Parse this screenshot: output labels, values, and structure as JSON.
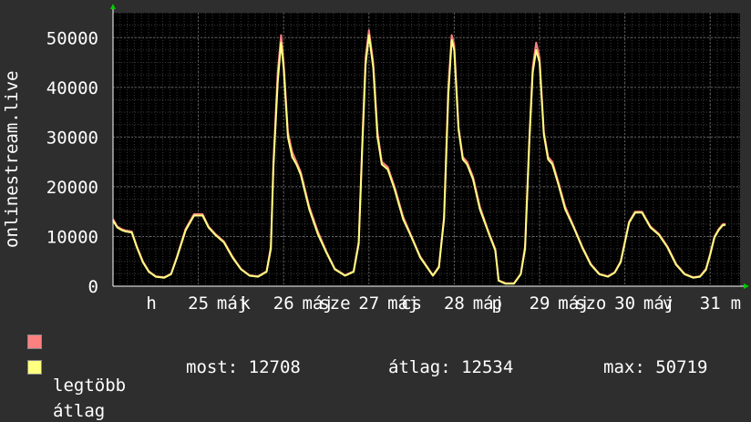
{
  "colors": {
    "background": "#2e2e2e",
    "plot_background": "#000000",
    "grid_major": "#606060",
    "grid_minor": "#3a3a3a",
    "max_line": "#ff8080",
    "avg_line": "#ffff80",
    "axis": "#ffffff",
    "arrow": "#00cc00"
  },
  "legend": {
    "max_label": "legtöbb",
    "avg_label": "átlag"
  },
  "stats": {
    "now": "most: 12708",
    "avg": "átlag: 12534",
    "max": "max: 50719"
  },
  "chart_data": {
    "type": "line",
    "ylabel": "onlinestream.live",
    "ylim": [
      0,
      55000
    ],
    "yticks": [
      0,
      10000,
      20000,
      30000,
      40000,
      50000
    ],
    "ytick_labels": [
      "0",
      "10000",
      "20000",
      "30000",
      "40000",
      "50000"
    ],
    "xlim": [
      24.0,
      31.35
    ],
    "grid": true,
    "xtick_labels": [
      {
        "x": 24.45,
        "label": "h"
      },
      {
        "x": 25.0,
        "label": "25"
      },
      {
        "x": 25.4,
        "label": "máj"
      },
      {
        "x": 25.55,
        "label": "k"
      },
      {
        "x": 26.0,
        "label": "26"
      },
      {
        "x": 26.4,
        "label": "máj"
      },
      {
        "x": 26.6,
        "label": "sze"
      },
      {
        "x": 27.0,
        "label": "27"
      },
      {
        "x": 27.4,
        "label": "máj"
      },
      {
        "x": 27.5,
        "label": "cs"
      },
      {
        "x": 28.0,
        "label": "28"
      },
      {
        "x": 28.4,
        "label": "máj"
      },
      {
        "x": 28.5,
        "label": "p"
      },
      {
        "x": 29.0,
        "label": "29"
      },
      {
        "x": 29.4,
        "label": "máj"
      },
      {
        "x": 29.6,
        "label": "szo"
      },
      {
        "x": 30.0,
        "label": "30"
      },
      {
        "x": 30.4,
        "label": "máj"
      },
      {
        "x": 30.5,
        "label": "v"
      },
      {
        "x": 31.0,
        "label": "31"
      },
      {
        "x": 31.3,
        "label": "m"
      }
    ],
    "series": [
      {
        "name": "legtöbb",
        "x": [
          24.0,
          24.05,
          24.1,
          24.15,
          24.22,
          24.28,
          24.35,
          24.42,
          24.5,
          24.6,
          24.68,
          24.75,
          24.85,
          24.95,
          25.05,
          25.12,
          25.2,
          25.3,
          25.4,
          25.5,
          25.6,
          25.7,
          25.8,
          25.85,
          25.88,
          25.93,
          25.97,
          26.0,
          26.05,
          26.1,
          26.15,
          26.2,
          26.3,
          26.4,
          26.5,
          26.6,
          26.72,
          26.82,
          26.88,
          26.92,
          26.96,
          27.0,
          27.05,
          27.1,
          27.15,
          27.22,
          27.3,
          27.4,
          27.5,
          27.6,
          27.75,
          27.82,
          27.88,
          27.93,
          27.97,
          28.0,
          28.05,
          28.1,
          28.15,
          28.22,
          28.3,
          28.4,
          28.48,
          28.5,
          28.52,
          28.6,
          28.7,
          28.78,
          28.83,
          28.88,
          28.92,
          28.96,
          29.0,
          29.05,
          29.1,
          29.15,
          29.22,
          29.3,
          29.4,
          29.5,
          29.6,
          29.7,
          29.8,
          29.88,
          29.95,
          30.05,
          30.12,
          30.2,
          30.3,
          30.4,
          30.5,
          30.6,
          30.7,
          30.8,
          30.88,
          30.95,
          31.0,
          31.05,
          31.1,
          31.15,
          31.18
        ],
        "y": [
          13500,
          12000,
          11500,
          11200,
          11000,
          8000,
          5000,
          3000,
          2000,
          1800,
          2500,
          6000,
          11500,
          14500,
          14500,
          12000,
          10500,
          9000,
          6000,
          3500,
          2200,
          2000,
          3000,
          8000,
          25000,
          43000,
          50500,
          45000,
          31000,
          27000,
          25000,
          23000,
          16000,
          11000,
          7000,
          3500,
          2200,
          3000,
          9000,
          28000,
          46000,
          51500,
          45000,
          31000,
          25000,
          24000,
          20000,
          14000,
          10000,
          6000,
          2200,
          4000,
          14000,
          40000,
          50500,
          48500,
          32000,
          26000,
          25000,
          22000,
          16000,
          11000,
          7500,
          4500,
          1200,
          600,
          600,
          2500,
          8000,
          30000,
          44000,
          49000,
          46000,
          31000,
          26000,
          25000,
          21000,
          16000,
          12000,
          8000,
          4500,
          2500,
          2000,
          2800,
          5000,
          13000,
          15000,
          15000,
          12000,
          10500,
          8000,
          4500,
          2500,
          1800,
          2000,
          3500,
          6500,
          10000,
          11500,
          12500,
          12500
        ]
      },
      {
        "name": "átlag",
        "x": [
          24.0,
          24.05,
          24.1,
          24.15,
          24.22,
          24.28,
          24.35,
          24.42,
          24.5,
          24.6,
          24.68,
          24.75,
          24.85,
          24.95,
          25.05,
          25.12,
          25.2,
          25.3,
          25.4,
          25.5,
          25.6,
          25.7,
          25.8,
          25.85,
          25.88,
          25.93,
          25.97,
          26.0,
          26.05,
          26.1,
          26.15,
          26.2,
          26.3,
          26.4,
          26.5,
          26.6,
          26.72,
          26.82,
          26.88,
          26.92,
          26.96,
          27.0,
          27.05,
          27.1,
          27.15,
          27.22,
          27.3,
          27.4,
          27.5,
          27.6,
          27.75,
          27.82,
          27.88,
          27.93,
          27.97,
          28.0,
          28.05,
          28.1,
          28.15,
          28.22,
          28.3,
          28.4,
          28.48,
          28.5,
          28.52,
          28.6,
          28.7,
          28.78,
          28.83,
          28.88,
          28.92,
          28.96,
          29.0,
          29.05,
          29.1,
          29.15,
          29.22,
          29.3,
          29.4,
          29.5,
          29.6,
          29.7,
          29.8,
          29.88,
          29.95,
          30.05,
          30.12,
          30.2,
          30.3,
          30.4,
          30.5,
          30.6,
          30.7,
          30.8,
          30.88,
          30.95,
          31.0,
          31.05,
          31.1,
          31.15,
          31.18
        ],
        "y": [
          13200,
          11800,
          11300,
          11000,
          10800,
          7800,
          4800,
          2900,
          1900,
          1700,
          2400,
          5800,
          11200,
          14200,
          14200,
          11800,
          10300,
          8800,
          5800,
          3400,
          2100,
          1900,
          2900,
          7500,
          24000,
          41000,
          49000,
          44000,
          30000,
          26000,
          24500,
          22500,
          15500,
          10500,
          6800,
          3400,
          2100,
          2900,
          8500,
          27000,
          44500,
          50500,
          44000,
          30000,
          24500,
          23500,
          19500,
          13500,
          9800,
          5800,
          2100,
          3800,
          13500,
          38500,
          49500,
          47500,
          31500,
          25500,
          24500,
          21500,
          15500,
          10800,
          7200,
          4300,
          1100,
          500,
          500,
          2400,
          7500,
          29000,
          43000,
          47500,
          45000,
          30500,
          25500,
          24500,
          20500,
          15500,
          11800,
          7800,
          4300,
          2400,
          1900,
          2700,
          4800,
          12800,
          14800,
          14800,
          11800,
          10300,
          7800,
          4300,
          2400,
          1700,
          1900,
          3300,
          6300,
          9800,
          11300,
          12300,
          12300
        ]
      }
    ]
  }
}
